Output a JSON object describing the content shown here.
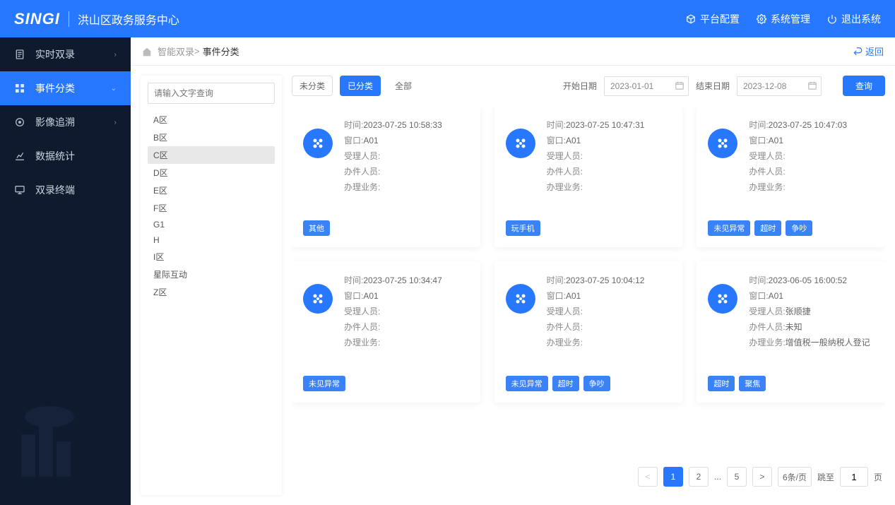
{
  "header": {
    "logo": "SINGI",
    "title": "洪山区政务服务中心",
    "right": [
      {
        "icon": "cube",
        "label": "平台配置"
      },
      {
        "icon": "gear",
        "label": "系统管理"
      },
      {
        "icon": "power",
        "label": "退出系统"
      }
    ]
  },
  "sidebar": {
    "items": [
      {
        "icon": "doc",
        "label": "实时双录",
        "arrow": "›"
      },
      {
        "icon": "grid",
        "label": "事件分类",
        "arrow": "⌄",
        "active": true
      },
      {
        "icon": "target",
        "label": "影像追溯",
        "arrow": "›"
      },
      {
        "icon": "chart",
        "label": "数据统计"
      },
      {
        "icon": "monitor",
        "label": "双录终端"
      }
    ]
  },
  "breadcrumb": {
    "root": "智能双录",
    "sep": ">",
    "current": "事件分类",
    "back": "返回"
  },
  "tree": {
    "placeholder": "请输入文字查询",
    "items": [
      "A区",
      "B区",
      "C区",
      "D区",
      "E区",
      "F区",
      "G1",
      "H",
      "I区",
      "星际互动",
      "Z区"
    ],
    "selected": "C区"
  },
  "filters": {
    "tab_unclass": "未分类",
    "tab_class": "已分类",
    "tab_all": "全部",
    "start_label": "开始日期",
    "start_val": "2023-01-01",
    "end_label": "结束日期",
    "end_val": "2023-12-08",
    "query": "查询"
  },
  "labels": {
    "time": "时间:",
    "window": "窗口:",
    "agent": "受理人员:",
    "handler": "办件人员:",
    "biz": "办理业务:"
  },
  "cards": [
    {
      "time": "2023-07-25 10:58:33",
      "window": "A01",
      "agent": "",
      "handler": "",
      "biz": "",
      "tags": [
        "其他"
      ]
    },
    {
      "time": "2023-07-25 10:47:31",
      "window": "A01",
      "agent": "",
      "handler": "",
      "biz": "",
      "tags": [
        "玩手机"
      ]
    },
    {
      "time": "2023-07-25 10:47:03",
      "window": "A01",
      "agent": "",
      "handler": "",
      "biz": "",
      "tags": [
        "未见异常",
        "超时",
        "争吵"
      ]
    },
    {
      "time": "2023-07-25 10:34:47",
      "window": "A01",
      "agent": "",
      "handler": "",
      "biz": "",
      "tags": [
        "未见异常"
      ]
    },
    {
      "time": "2023-07-25 10:04:12",
      "window": "A01",
      "agent": "",
      "handler": "",
      "biz": "",
      "tags": [
        "未见异常",
        "超时",
        "争吵"
      ]
    },
    {
      "time": "2023-06-05 16:00:52",
      "window": "A01",
      "agent": "张顺捷",
      "handler": "未知",
      "biz": "增值税一般纳税人登记",
      "tags": [
        "超时",
        "聚焦"
      ]
    }
  ],
  "pagination": {
    "prev": "<",
    "pages": [
      "1",
      "2"
    ],
    "ellipsis": "...",
    "last": "5",
    "next": ">",
    "size": "6条/页",
    "jump_label": "跳至",
    "jump_val": "1",
    "jump_suffix": "页"
  }
}
